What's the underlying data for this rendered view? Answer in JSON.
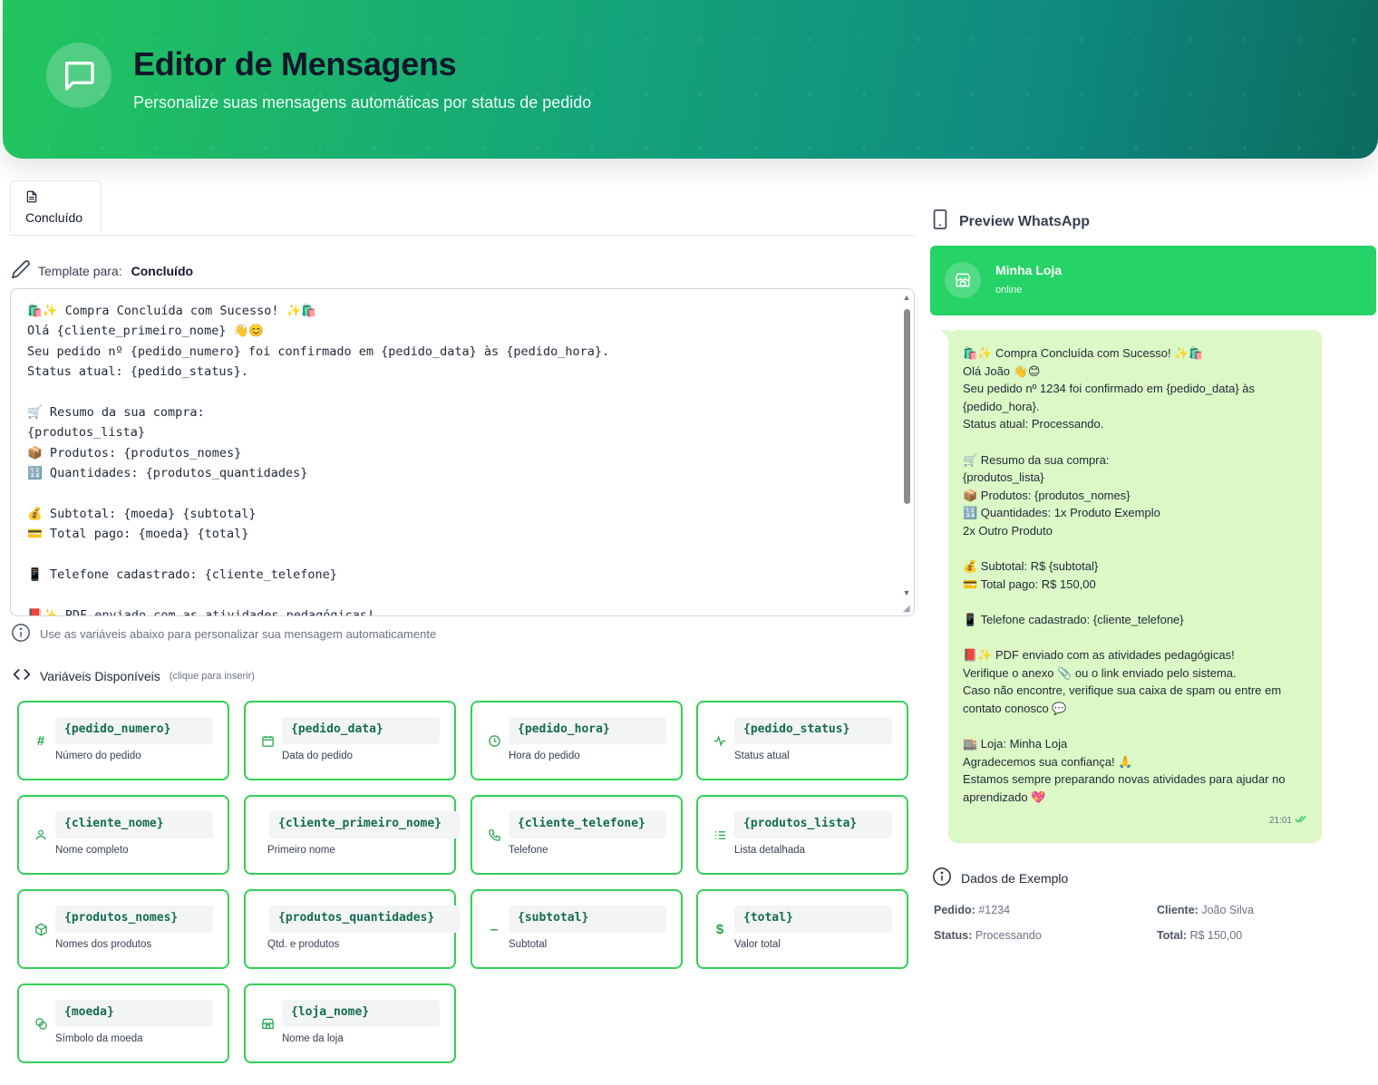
{
  "header": {
    "title": "Editor de Mensagens",
    "subtitle": "Personalize suas mensagens automáticas por status de pedido",
    "icon": "message-square-icon"
  },
  "tabs": [
    {
      "label": "Concluído",
      "icon": "file-text-icon"
    }
  ],
  "editor": {
    "template_prefix": "Template para:",
    "status_name": "Concluído",
    "content": "🛍️✨ Compra Concluída com Sucesso! ✨🛍️\nOlá {cliente_primeiro_nome} 👋😊\nSeu pedido nº {pedido_numero} foi confirmado em {pedido_data} às {pedido_hora}.\nStatus atual: {pedido_status}.\n\n🛒 Resumo da sua compra:\n{produtos_lista}\n📦 Produtos: {produtos_nomes}\n🔢 Quantidades: {produtos_quantidades}\n\n💰 Subtotal: {moeda} {subtotal}\n💳 Total pago: {moeda} {total}\n\n📱 Telefone cadastrado: {cliente_telefone}\n\n📕✨ PDF enviado com as atividades pedagógicas!",
    "hint": "Use as variáveis abaixo para personalizar sua mensagem automaticamente"
  },
  "variables": {
    "title": "Variáveis Disponíveis",
    "subtitle": "(clique para inserir)",
    "items": [
      {
        "code": "{pedido_numero}",
        "desc": "Número do pedido",
        "icon": "hash-icon"
      },
      {
        "code": "{pedido_data}",
        "desc": "Data do pedido",
        "icon": "calendar-icon"
      },
      {
        "code": "{pedido_hora}",
        "desc": "Hora do pedido",
        "icon": "clock-icon"
      },
      {
        "code": "{pedido_status}",
        "desc": "Status atual",
        "icon": "activity-icon"
      },
      {
        "code": "{cliente_nome}",
        "desc": "Nome completo",
        "icon": "user-icon"
      },
      {
        "code": "{cliente_primeiro_nome}",
        "desc": "Primeiro nome",
        "icon": "user-icon"
      },
      {
        "code": "{cliente_telefone}",
        "desc": "Telefone",
        "icon": "phone-icon"
      },
      {
        "code": "{produtos_lista}",
        "desc": "Lista detalhada",
        "icon": "list-icon"
      },
      {
        "code": "{produtos_nomes}",
        "desc": "Nomes dos produtos",
        "icon": "package-icon"
      },
      {
        "code": "{produtos_quantidades}",
        "desc": "Qtd. e produtos",
        "icon": "package-icon"
      },
      {
        "code": "{subtotal}",
        "desc": "Subtotal",
        "icon": "minus-icon"
      },
      {
        "code": "{total}",
        "desc": "Valor total",
        "icon": "dollar-icon"
      },
      {
        "code": "{moeda}",
        "desc": "Símbolo da moeda",
        "icon": "coins-icon"
      },
      {
        "code": "{loja_nome}",
        "desc": "Nome da loja",
        "icon": "store-icon"
      }
    ]
  },
  "preview": {
    "title": "Preview WhatsApp",
    "store_name": "Minha Loja",
    "store_status": "online",
    "message": "🛍️✨ Compra Concluída com Sucesso! ✨🛍️\nOlá João 👋😊\nSeu pedido nº 1234 foi confirmado em {pedido_data} às {pedido_hora}.\nStatus atual: Processando.\n\n🛒 Resumo da sua compra:\n{produtos_lista}\n📦 Produtos: {produtos_nomes}\n🔢 Quantidades: 1x Produto Exemplo\n2x Outro Produto\n\n💰 Subtotal: R$ {subtotal}\n💳 Total pago: R$ 150,00\n\n📱 Telefone cadastrado: {cliente_telefone}\n\n📕✨ PDF enviado com as atividades pedagógicas!\nVerifique o anexo 📎 ou o link enviado pelo sistema.\nCaso não encontre, verifique sua caixa de spam ou entre em contato conosco 💬\n\n🏬 Loja: Minha Loja\nAgradecemos sua confiança! 🙏\nEstamos sempre preparando novas atividades para ajudar no aprendizado 💖",
    "time": "21:01"
  },
  "example": {
    "title": "Dados de Exemplo",
    "pedido_label": "Pedido:",
    "pedido_value": "#1234",
    "cliente_label": "Cliente:",
    "cliente_value": "João Silva",
    "status_label": "Status:",
    "status_value": "Processando",
    "total_label": "Total:",
    "total_value": "R$ 150,00"
  },
  "colors": {
    "accent": "#25d366",
    "card_border": "#34d058",
    "code_text": "#136c4e",
    "bubble": "#dcf8c6"
  }
}
